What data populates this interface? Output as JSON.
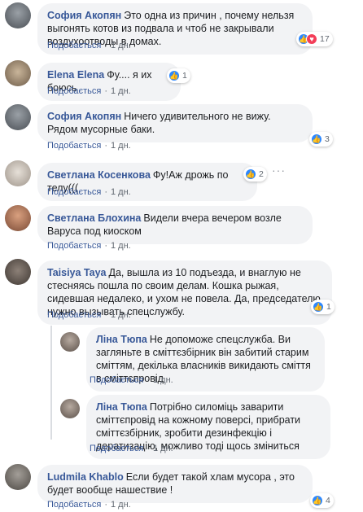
{
  "reply_label": "Подобається",
  "comments": [
    {
      "name": "София Акопян",
      "text": "Это одна из причин , почему нельзя выгонять котов из подвала и чтоб не закрывали воздухоотводы в домах.",
      "time": "1 дн.",
      "reactions": "17"
    },
    {
      "name": "Elena Elena",
      "text": "Фу.... я их боюсь",
      "time": "1 дн.",
      "reactions": "1"
    },
    {
      "name": "София Акопян",
      "text": "Ничего удивительного не вижу. Рядом мусорные баки.",
      "time": "1 дн.",
      "reactions": "3"
    },
    {
      "name": "Светлана Косенкова",
      "text": "Фу!Аж дрожь по телу(((",
      "time": "1 дн.",
      "reactions": "2"
    },
    {
      "name": "Светлана Блохина",
      "text": "Видели вчера вечером возле Варуса под киоском",
      "time": "1 дн."
    },
    {
      "name": "Taisiya Taya",
      "text": "Да, вышла из 10 подъезда, и внаглую не стесняясь пошла по своим делам. Кошка рыжая, сидевшая недалеко, и ухом не повела. Да, председателю нужно вызывать спецслужбу.",
      "time": "1 дн.",
      "reactions": "1"
    },
    {
      "name": "Ліна Тюпа",
      "text": "Не допоможе спецслужба. Ви загляньте в сміттєзбірник він забитий старим сміттям, декілька власників викидають сміття в сміттєпровід",
      "time": "1 дн."
    },
    {
      "name": "Ліна Тюпа",
      "text": "Потрібно силоміць заварити сміттєпровід на кожному поверсі, прибрати сміттєзбірник, зробити дезинфекцію і дератизацію, можливо тоді щось зміниться",
      "time": "1 дн."
    },
    {
      "name": "Ludmila Khablo",
      "text": "Если будет такой хлам мусора , это будет вообще нашествие !",
      "time": "1 дн.",
      "reactions": "4"
    }
  ],
  "colors": {
    "link": "#385898",
    "bubble": "#f2f3f5",
    "like": "#2d88ff",
    "love": "#f33e58"
  }
}
